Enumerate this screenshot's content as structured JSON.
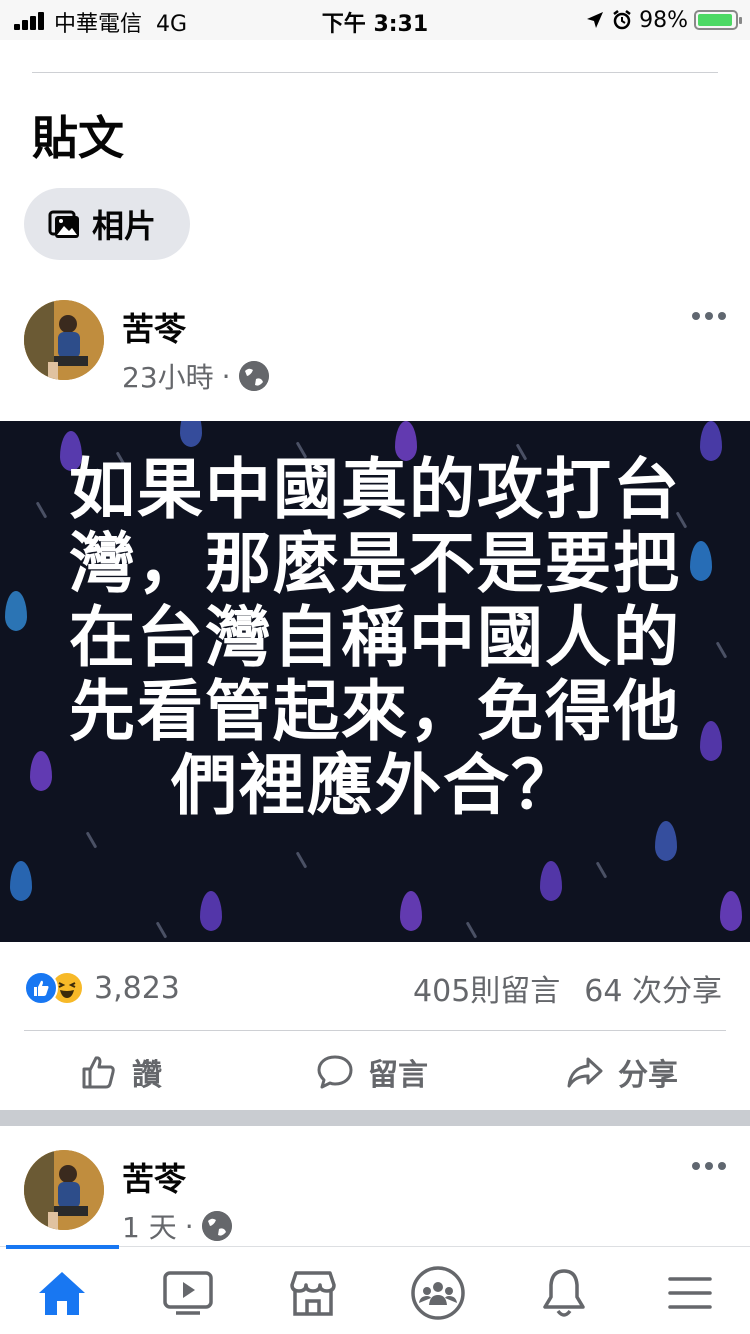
{
  "status_bar": {
    "carrier": "中華電信",
    "network": "4G",
    "time": "下午 3:31",
    "battery": "98%"
  },
  "section": {
    "title": "貼文",
    "photos_label": "相片"
  },
  "posts": [
    {
      "author": "苦苓",
      "time": "23小時",
      "dot": "·",
      "image_text": "如果中國真的攻打台灣，那麼是不是要把在台灣自稱中國人的先看管起來，免得他們裡應外合？",
      "reaction_count": "3,823",
      "comments": "405則留言",
      "shares": "64 次分享"
    },
    {
      "author": "苦苓",
      "time": "1 天",
      "dot": "·"
    }
  ],
  "actions": {
    "like": "讚",
    "comment": "留言",
    "share": "分享"
  },
  "nav": {
    "items": [
      "home-icon",
      "watch-icon",
      "marketplace-icon",
      "groups-icon",
      "notifications-icon",
      "menu-icon"
    ],
    "active_color": "#1877f2",
    "inactive_color": "#65676b"
  },
  "colors": {
    "accent": "#1877f2",
    "secondary_text": "#65676b",
    "chip_bg": "#e4e6eb"
  }
}
